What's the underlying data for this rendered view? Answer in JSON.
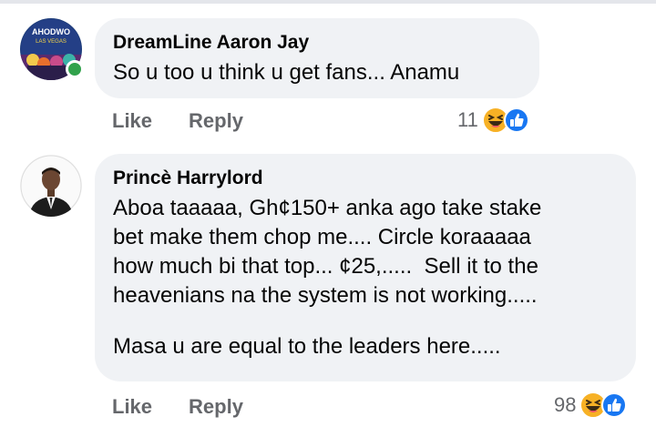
{
  "comments": [
    {
      "author": "DreamLine Aaron Jay",
      "avatar_text": [
        "AHODWO",
        "LAS VEGAS"
      ],
      "online": true,
      "lines": [
        "So u too u think u get fans... Anamu"
      ],
      "actions": {
        "like": "Like",
        "reply": "Reply"
      },
      "reaction_count": "11",
      "reaction_icons": [
        "haha-icon",
        "like-icon"
      ]
    },
    {
      "author": "Princè Harrylord",
      "online": false,
      "lines": [
        "Aboa taaaaa, Gh¢150+ anka ago take stake",
        "bet make them chop me.... Circle koraaaaa",
        "how much bi that top... ¢25,.....  Sell it to the",
        "heavenians na the system is not working.....",
        "",
        "Masa u are equal to the leaders here....."
      ],
      "actions": {
        "like": "Like",
        "reply": "Reply"
      },
      "reaction_count": "98",
      "reaction_icons": [
        "haha-icon",
        "like-icon"
      ]
    }
  ],
  "colors": {
    "bubble": "#f0f2f5",
    "meta_text": "#65676b",
    "online": "#31a24c",
    "like_blue": "#1877f2",
    "haha_yellow": "#f7b125"
  }
}
